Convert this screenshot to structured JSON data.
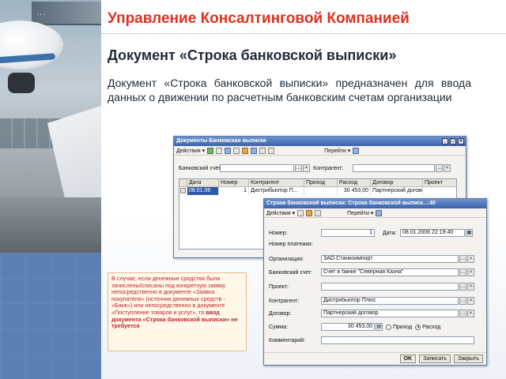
{
  "background": {
    "photo_sign_text": "...",
    "accent_color": "#e0301e",
    "panel_color": "#5d7fb2"
  },
  "header": {
    "title": "Управление Консалтинговой Компанией",
    "subtitle": "Документ «Строка банковской выписки»",
    "description": "Документ «Строка банковской выписки» предназначен для ввода данных о движении по расчетным банковским счетам организации"
  },
  "list_window": {
    "title": "Документы Банковская выписка",
    "toolbar": {
      "actions_label": "Действия",
      "goto_label": "Перейти",
      "icons": [
        "add-icon",
        "copy-icon",
        "edit-icon",
        "delete-icon",
        "post-icon",
        "filter-icon",
        "sort-icon",
        "refresh-icon",
        "help-icon"
      ]
    },
    "bank_account_label": "Банковский счет:",
    "bank_account_value": "",
    "counterparty_label": "Контрагент:",
    "counterparty_value": "",
    "columns": [
      "Дата",
      "Номер",
      "Контрагент",
      "Приход",
      "Расход",
      "Договор",
      "Проект"
    ],
    "rows": [
      {
        "date": "08.01.06",
        "number": "1",
        "counterparty": "Дистрибьютор П...",
        "income": "",
        "expense": "30 453,00",
        "contract": "Партнерский договор",
        "project": ""
      }
    ]
  },
  "doc_window": {
    "title": "Строка банковской выписки: Строка банковской выписк...:40",
    "toolbar": {
      "actions_label": "Действия",
      "goto_label": "Перейти",
      "icons": [
        "save-icon",
        "post-icon",
        "print-icon",
        "help-icon"
      ]
    },
    "fields": {
      "number_label": "Номер:",
      "number_value": "1",
      "date_label": "Дата:",
      "date_value": "08.01.2006 22:19:40",
      "payment_number_label": "Номер платежки:",
      "payment_number_value": "",
      "organization_label": "Организация:",
      "organization_value": "ЗАО Станкоимпорт",
      "bank_account_label": "Банковский счет:",
      "bank_account_value": "Счет в банке \"Северная Казна\"",
      "project_label": "Проект:",
      "project_value": "",
      "counterparty_label": "Контрагент:",
      "counterparty_value": "Дистрибьютор Плюс",
      "contract_label": "Договор:",
      "contract_value": "Партнерский договор",
      "amount_label": "Сумма:",
      "amount_value": "30 453,00",
      "income_label": "Приход",
      "expense_label": "Расход",
      "direction_selected": "Расход",
      "comment_label": "Комментарий:",
      "comment_value": ""
    },
    "buttons": {
      "ok_label": "OK",
      "save_label": "Записать",
      "close_label": "Закрыть"
    }
  },
  "note": {
    "text": "В случае, если денежные средства были зачислены/списаны под конкретную заявку непосредственно в документе «Заявка покупателя» (источник денежных средств - «Банк») или непосредственно в документе «Поступление товаров и услуг», то",
    "bold_text": "ввод документа «Строка банковской выписки» не требуется"
  }
}
